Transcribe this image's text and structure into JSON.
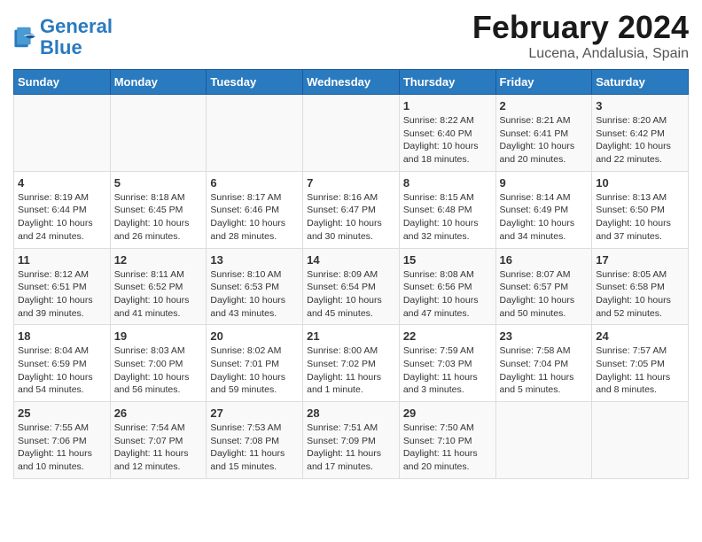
{
  "header": {
    "logo_general": "General",
    "logo_blue": "Blue",
    "main_title": "February 2024",
    "subtitle": "Lucena, Andalusia, Spain"
  },
  "weekdays": [
    "Sunday",
    "Monday",
    "Tuesday",
    "Wednesday",
    "Thursday",
    "Friday",
    "Saturday"
  ],
  "rows": [
    [
      {
        "num": "",
        "info": ""
      },
      {
        "num": "",
        "info": ""
      },
      {
        "num": "",
        "info": ""
      },
      {
        "num": "",
        "info": ""
      },
      {
        "num": "1",
        "info": "Sunrise: 8:22 AM\nSunset: 6:40 PM\nDaylight: 10 hours\nand 18 minutes."
      },
      {
        "num": "2",
        "info": "Sunrise: 8:21 AM\nSunset: 6:41 PM\nDaylight: 10 hours\nand 20 minutes."
      },
      {
        "num": "3",
        "info": "Sunrise: 8:20 AM\nSunset: 6:42 PM\nDaylight: 10 hours\nand 22 minutes."
      }
    ],
    [
      {
        "num": "4",
        "info": "Sunrise: 8:19 AM\nSunset: 6:44 PM\nDaylight: 10 hours\nand 24 minutes."
      },
      {
        "num": "5",
        "info": "Sunrise: 8:18 AM\nSunset: 6:45 PM\nDaylight: 10 hours\nand 26 minutes."
      },
      {
        "num": "6",
        "info": "Sunrise: 8:17 AM\nSunset: 6:46 PM\nDaylight: 10 hours\nand 28 minutes."
      },
      {
        "num": "7",
        "info": "Sunrise: 8:16 AM\nSunset: 6:47 PM\nDaylight: 10 hours\nand 30 minutes."
      },
      {
        "num": "8",
        "info": "Sunrise: 8:15 AM\nSunset: 6:48 PM\nDaylight: 10 hours\nand 32 minutes."
      },
      {
        "num": "9",
        "info": "Sunrise: 8:14 AM\nSunset: 6:49 PM\nDaylight: 10 hours\nand 34 minutes."
      },
      {
        "num": "10",
        "info": "Sunrise: 8:13 AM\nSunset: 6:50 PM\nDaylight: 10 hours\nand 37 minutes."
      }
    ],
    [
      {
        "num": "11",
        "info": "Sunrise: 8:12 AM\nSunset: 6:51 PM\nDaylight: 10 hours\nand 39 minutes."
      },
      {
        "num": "12",
        "info": "Sunrise: 8:11 AM\nSunset: 6:52 PM\nDaylight: 10 hours\nand 41 minutes."
      },
      {
        "num": "13",
        "info": "Sunrise: 8:10 AM\nSunset: 6:53 PM\nDaylight: 10 hours\nand 43 minutes."
      },
      {
        "num": "14",
        "info": "Sunrise: 8:09 AM\nSunset: 6:54 PM\nDaylight: 10 hours\nand 45 minutes."
      },
      {
        "num": "15",
        "info": "Sunrise: 8:08 AM\nSunset: 6:56 PM\nDaylight: 10 hours\nand 47 minutes."
      },
      {
        "num": "16",
        "info": "Sunrise: 8:07 AM\nSunset: 6:57 PM\nDaylight: 10 hours\nand 50 minutes."
      },
      {
        "num": "17",
        "info": "Sunrise: 8:05 AM\nSunset: 6:58 PM\nDaylight: 10 hours\nand 52 minutes."
      }
    ],
    [
      {
        "num": "18",
        "info": "Sunrise: 8:04 AM\nSunset: 6:59 PM\nDaylight: 10 hours\nand 54 minutes."
      },
      {
        "num": "19",
        "info": "Sunrise: 8:03 AM\nSunset: 7:00 PM\nDaylight: 10 hours\nand 56 minutes."
      },
      {
        "num": "20",
        "info": "Sunrise: 8:02 AM\nSunset: 7:01 PM\nDaylight: 10 hours\nand 59 minutes."
      },
      {
        "num": "21",
        "info": "Sunrise: 8:00 AM\nSunset: 7:02 PM\nDaylight: 11 hours\nand 1 minute."
      },
      {
        "num": "22",
        "info": "Sunrise: 7:59 AM\nSunset: 7:03 PM\nDaylight: 11 hours\nand 3 minutes."
      },
      {
        "num": "23",
        "info": "Sunrise: 7:58 AM\nSunset: 7:04 PM\nDaylight: 11 hours\nand 5 minutes."
      },
      {
        "num": "24",
        "info": "Sunrise: 7:57 AM\nSunset: 7:05 PM\nDaylight: 11 hours\nand 8 minutes."
      }
    ],
    [
      {
        "num": "25",
        "info": "Sunrise: 7:55 AM\nSunset: 7:06 PM\nDaylight: 11 hours\nand 10 minutes."
      },
      {
        "num": "26",
        "info": "Sunrise: 7:54 AM\nSunset: 7:07 PM\nDaylight: 11 hours\nand 12 minutes."
      },
      {
        "num": "27",
        "info": "Sunrise: 7:53 AM\nSunset: 7:08 PM\nDaylight: 11 hours\nand 15 minutes."
      },
      {
        "num": "28",
        "info": "Sunrise: 7:51 AM\nSunset: 7:09 PM\nDaylight: 11 hours\nand 17 minutes."
      },
      {
        "num": "29",
        "info": "Sunrise: 7:50 AM\nSunset: 7:10 PM\nDaylight: 11 hours\nand 20 minutes."
      },
      {
        "num": "",
        "info": ""
      },
      {
        "num": "",
        "info": ""
      }
    ]
  ]
}
